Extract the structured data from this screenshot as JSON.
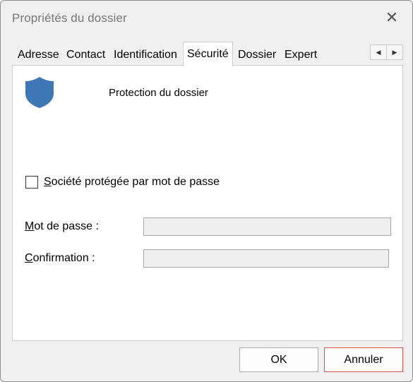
{
  "window": {
    "title": "Propriétés du dossier",
    "close_glyph": "✕"
  },
  "tabs": [
    {
      "label": "Adresse"
    },
    {
      "label": "Contact"
    },
    {
      "label": "Identification"
    },
    {
      "label": "Sécurité",
      "active": true
    },
    {
      "label": "Dossier"
    },
    {
      "label": "Expert"
    }
  ],
  "tab_scroll": {
    "left": "◀",
    "right": "▶"
  },
  "security": {
    "icon": "shield-icon",
    "heading": "Protection du dossier",
    "checkbox": {
      "label_mnemonic": "S",
      "label_rest": "ociété protégée par mot de passe",
      "checked": false
    },
    "password": {
      "label_mnemonic": "M",
      "label_rest": "ot de passe :",
      "value": ""
    },
    "confirmation": {
      "label_mnemonic": "C",
      "label_rest": "onfirmation :",
      "value": ""
    }
  },
  "footer": {
    "ok_label": "OK",
    "cancel_label": "Annuler"
  },
  "colors": {
    "shield": "#3d77b6",
    "cancel_border": "#d9534f"
  }
}
